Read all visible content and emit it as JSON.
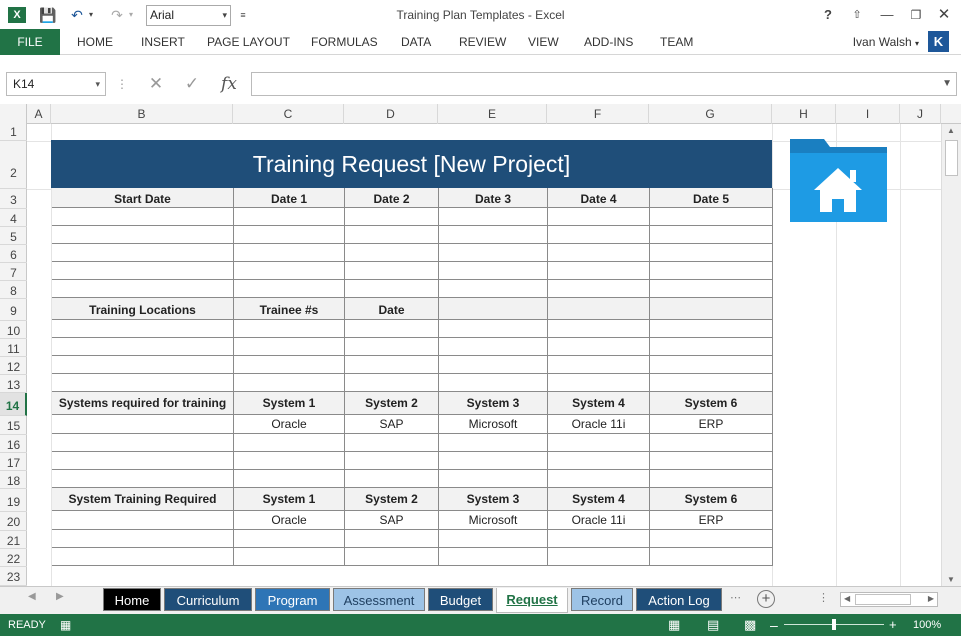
{
  "app": {
    "window_title": "Training Plan Templates - Excel",
    "font_name": "Arial",
    "colors": {
      "accent": "#217346",
      "banner": "#1f4e79",
      "folder": "#1e9be4"
    }
  },
  "ribbon": {
    "file": "FILE",
    "tabs": [
      "HOME",
      "INSERT",
      "PAGE LAYOUT",
      "FORMULAS",
      "DATA",
      "REVIEW",
      "VIEW",
      "ADD-INS",
      "TEAM"
    ],
    "user": "Ivan Walsh",
    "avatar": "K"
  },
  "formula_bar": {
    "name_box": "K14",
    "fx": "fx",
    "value": ""
  },
  "columns": [
    "A",
    "B",
    "C",
    "D",
    "E",
    "F",
    "G",
    "H",
    "I",
    "J"
  ],
  "rows": [
    "1",
    "2",
    "3",
    "4",
    "5",
    "6",
    "7",
    "8",
    "9",
    "10",
    "11",
    "12",
    "13",
    "14",
    "15",
    "16",
    "17",
    "18",
    "19",
    "20",
    "21",
    "22",
    "23"
  ],
  "form": {
    "title": "Training Request [New Project]",
    "section1": {
      "headers": [
        "Start Date",
        "Date 1",
        "Date 2",
        "Date 3",
        "Date 4",
        "Date 5"
      ]
    },
    "section2": {
      "headers": [
        "Training Locations",
        "Trainee #s",
        "Date",
        "",
        "",
        ""
      ]
    },
    "section3": {
      "headers": [
        "Systems required for training",
        "System 1",
        "System 2",
        "System 3",
        "System 4",
        "System 6"
      ],
      "values": [
        "",
        "Oracle",
        "SAP",
        "Microsoft",
        "Oracle 11i",
        "ERP"
      ]
    },
    "section4": {
      "headers": [
        "System Training Required",
        "System 1",
        "System 2",
        "System 3",
        "System 4",
        "System 6"
      ],
      "values": [
        "",
        "Oracle",
        "SAP",
        "Microsoft",
        "Oracle 11i",
        "ERP"
      ]
    }
  },
  "sheet_tabs": [
    {
      "label": "Home",
      "color": "#000000"
    },
    {
      "label": "Curriculum",
      "color": "#1f4e79"
    },
    {
      "label": "Program",
      "color": "#2e75b6"
    },
    {
      "label": "Assessment",
      "color": "#9dc3e6"
    },
    {
      "label": "Budget",
      "color": "#1f4e79"
    },
    {
      "label": "Request",
      "color": "#ffffff"
    },
    {
      "label": "Record",
      "color": "#9dc3e6"
    },
    {
      "label": "Action Log",
      "color": "#1f4e79"
    }
  ],
  "status": {
    "ready": "READY",
    "zoom": "100%"
  }
}
